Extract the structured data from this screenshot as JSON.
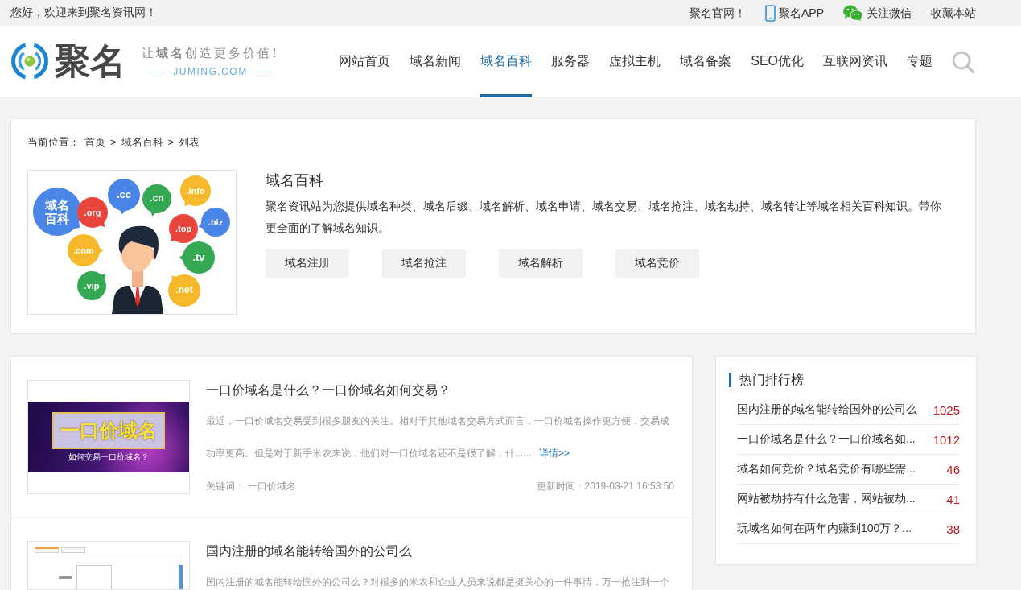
{
  "top_bar": {
    "greeting": "您好，欢迎来到聚名资讯网！",
    "links": [
      {
        "kind": "plain",
        "label": "聚名官网！"
      },
      {
        "kind": "phone",
        "label": "聚名APP"
      },
      {
        "kind": "chat",
        "label": "关注微信"
      },
      {
        "kind": "plain",
        "label": "收藏本站"
      }
    ]
  },
  "header": {
    "logo": {
      "name": "聚名",
      "slogan": "让**域名**创造更多价值!",
      "domain": "JUMING.COM"
    },
    "nav": [
      {
        "label": "网站首页",
        "selected": false
      },
      {
        "label": "域名新闻",
        "selected": false
      },
      {
        "label": "域名百科",
        "selected": true
      },
      {
        "label": "服务器",
        "selected": false
      },
      {
        "label": "虚拟主机",
        "selected": false
      },
      {
        "label": "域名备案",
        "selected": false
      },
      {
        "label": "SEO优化",
        "selected": false
      },
      {
        "label": "互联网资讯",
        "selected": false
      },
      {
        "label": "专题",
        "selected": false
      }
    ]
  },
  "breadcrumb": {
    "prefix": "当前位置：",
    "separator": ">",
    "items": [
      "首页",
      "域名百科",
      "列表"
    ]
  },
  "intro": {
    "image": {
      "bubbles": [
        {
          "text": "域名百科",
          "color": "#4a86e8"
        },
        {
          "text": ".org",
          "color": "#e8453c"
        },
        {
          "text": ".cc",
          "color": "#4a86e8"
        },
        {
          "text": ".cn",
          "color": "#34a853"
        },
        {
          "text": ".info",
          "color": "#f6b92b"
        },
        {
          "text": ".top",
          "color": "#e8453c"
        },
        {
          "text": ".biz",
          "color": "#4a86e8"
        },
        {
          "text": ".com",
          "color": "#f6b92b"
        },
        {
          "text": ".tv",
          "color": "#34a853"
        },
        {
          "text": ".vip",
          "color": "#34a853"
        },
        {
          "text": ".net",
          "color": "#f6b92b"
        }
      ]
    },
    "title": "域名百科",
    "description": "聚名资讯站为您提供域名种类、域名后缀、域名解析、域名申请、域名交易、域名抢注、域名劫持、域名转让等域名相关百科知识。带你更全面的了解域名知识。",
    "buttons": [
      "域名注册",
      "域名抢注",
      "域名解析",
      "域名竞价"
    ]
  },
  "articles": [
    {
      "thumbnail": {
        "kind": "banner",
        "headline": "一口价域名",
        "subline": "如何交易一口价域名？"
      },
      "title": "一口价域名是什么？一口价域名如何交易？",
      "excerpt": "最近，一口价域名交易受到很多朋友的关注。相对于其他域名交易方式而言，一口价域名操作更方便，交易成功率更高。但是对于新手米农来说，他们对一口价域名还不是很了解，什......",
      "more": "详情>>",
      "keywords_label": "关键词：",
      "keywords": "一口价域名",
      "updated": "更新时间：2019-03-21 16:53:50"
    },
    {
      "thumbnail": {
        "kind": "screenshot"
      },
      "title": "国内注册的域名能转给国外的公司么",
      "excerpt": "国内注册的域名能转给国外的公司么？对很多的米农和企业人员来说都是挺关心的一件事情，万一抢注到一个"
    }
  ],
  "ranking": {
    "title": "热门排行榜",
    "items": [
      {
        "title": "国内注册的域名能转给国外的公司么",
        "count": "1025"
      },
      {
        "title": "一口价域名是什么？一口价域名如...",
        "count": "1012"
      },
      {
        "title": "域名如何竞价？域名竞价有哪些需...",
        "count": "46"
      },
      {
        "title": "网站被劫持有什么危害，网站被劫...",
        "count": "41"
      },
      {
        "title": "玩域名如何在两年内赚到100万？...",
        "count": "38"
      }
    ]
  }
}
